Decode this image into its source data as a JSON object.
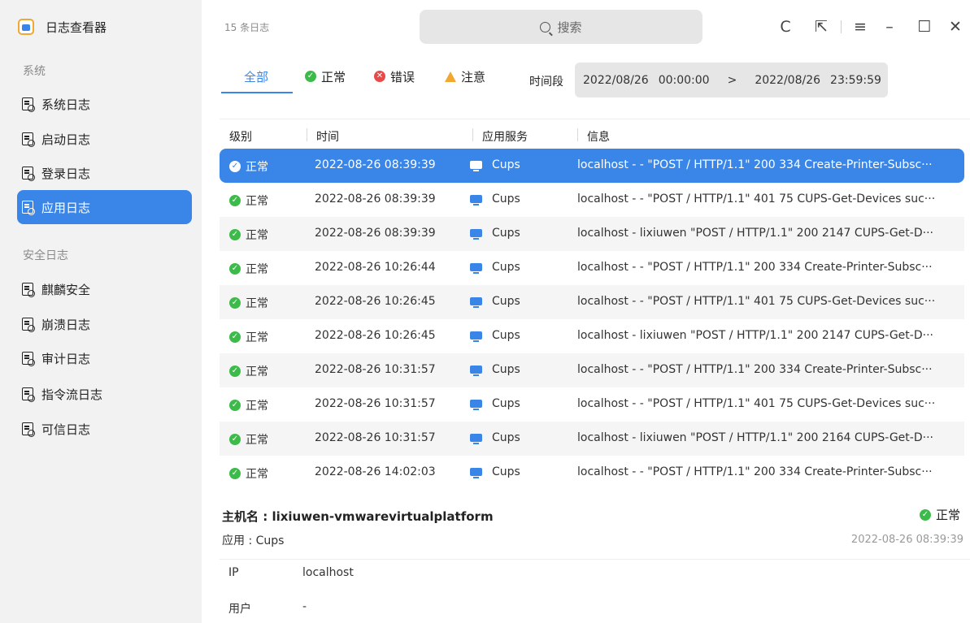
{
  "app": {
    "title": "日志查看器"
  },
  "sidebar": {
    "section_system": "系统",
    "section_security": "安全日志",
    "items": [
      {
        "label": "系统日志",
        "icon": "system-log-icon"
      },
      {
        "label": "启动日志",
        "icon": "boot-log-icon"
      },
      {
        "label": "登录日志",
        "icon": "login-log-icon"
      },
      {
        "label": "应用日志",
        "icon": "app-log-icon",
        "active": true
      },
      {
        "label": "麒麟安全",
        "icon": "kylin-security-icon"
      },
      {
        "label": "崩溃日志",
        "icon": "crash-log-icon"
      },
      {
        "label": "审计日志",
        "icon": "audit-log-icon"
      },
      {
        "label": "指令流日志",
        "icon": "command-flow-log-icon"
      },
      {
        "label": "可信日志",
        "icon": "trusted-log-icon"
      }
    ]
  },
  "header": {
    "count": "15 条日志",
    "search_placeholder": "搜索"
  },
  "toolbar": {
    "refresh": "C",
    "export": "⇱",
    "menu": "≡",
    "minimize": "–",
    "maximize": "☐",
    "close": "✕"
  },
  "filters": {
    "all": "全部",
    "normal": "正常",
    "error": "错误",
    "warning": "注意",
    "period_label": "时间段",
    "start_date": "2022/08/26",
    "start_time": "00:00:00",
    "arrow": ">",
    "end_date": "2022/08/26",
    "end_time": "23:59:59"
  },
  "table": {
    "headers": [
      "级别",
      "时间",
      "应用服务",
      "信息"
    ],
    "rows": [
      {
        "level": "正常",
        "time": "2022-08-26 08:39:39",
        "app": "Cups",
        "info": "localhost - - \"POST / HTTP/1.1\" 200 334 Create-Printer-Subsc···"
      },
      {
        "level": "正常",
        "time": "2022-08-26 08:39:39",
        "app": "Cups",
        "info": "localhost - - \"POST / HTTP/1.1\" 401 75 CUPS-Get-Devices suc···"
      },
      {
        "level": "正常",
        "time": "2022-08-26 08:39:39",
        "app": "Cups",
        "info": "localhost - lixiuwen \"POST / HTTP/1.1\" 200 2147 CUPS-Get-D···"
      },
      {
        "level": "正常",
        "time": "2022-08-26 10:26:44",
        "app": "Cups",
        "info": "localhost - - \"POST / HTTP/1.1\" 200 334 Create-Printer-Subsc···"
      },
      {
        "level": "正常",
        "time": "2022-08-26 10:26:45",
        "app": "Cups",
        "info": "localhost - - \"POST / HTTP/1.1\" 401 75 CUPS-Get-Devices suc···"
      },
      {
        "level": "正常",
        "time": "2022-08-26 10:26:45",
        "app": "Cups",
        "info": "localhost - lixiuwen \"POST / HTTP/1.1\" 200 2147 CUPS-Get-D···"
      },
      {
        "level": "正常",
        "time": "2022-08-26 10:31:57",
        "app": "Cups",
        "info": "localhost - - \"POST / HTTP/1.1\" 200 334 Create-Printer-Subsc···"
      },
      {
        "level": "正常",
        "time": "2022-08-26 10:31:57",
        "app": "Cups",
        "info": "localhost - - \"POST / HTTP/1.1\" 401 75 CUPS-Get-Devices suc···"
      },
      {
        "level": "正常",
        "time": "2022-08-26 10:31:57",
        "app": "Cups",
        "info": "localhost - lixiuwen \"POST / HTTP/1.1\" 200 2164 CUPS-Get-D···"
      },
      {
        "level": "正常",
        "time": "2022-08-26 14:02:03",
        "app": "Cups",
        "info": "localhost - - \"POST / HTTP/1.1\" 200 334 Create-Printer-Subsc···"
      }
    ]
  },
  "detail": {
    "host": "主机名 : lixiuwen-vmwarevirtualplatform",
    "status": "正常",
    "app": "应用 : Cups",
    "time": "2022-08-26 08:39:39",
    "ip_label": "IP",
    "ip_value": "localhost",
    "user_label": "用户",
    "user_value": "-"
  },
  "colors": {
    "accent": "#3a86e8",
    "ok": "#3cbb4a",
    "error": "#e84a4a",
    "warning": "#f0a830"
  }
}
